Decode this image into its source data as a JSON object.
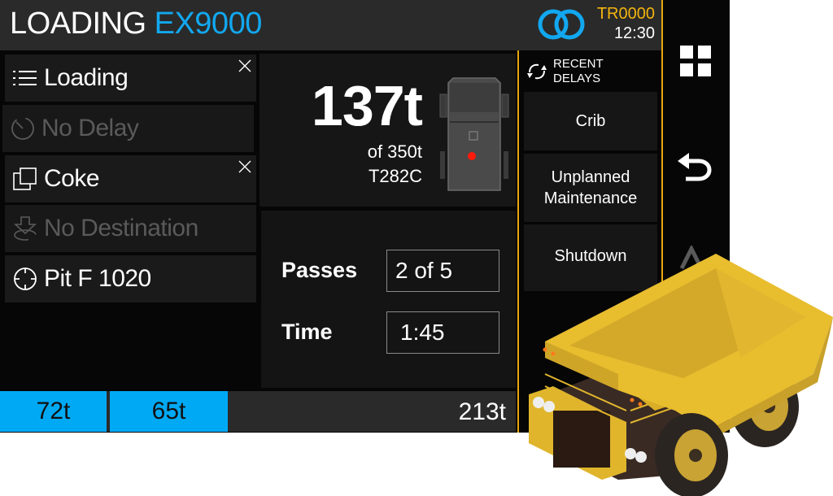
{
  "header": {
    "title_prefix": "LOADING",
    "title_machine": "EX9000",
    "truck_id": "TR0000",
    "clock": "12:30",
    "brand_icon": "linked-rings-icon"
  },
  "colors": {
    "accent_blue": "#12a8f0",
    "accent_yellow": "#f2b40f",
    "divider_orange": "#e8a70e",
    "load_red": "#ff1a0a"
  },
  "left_panel": {
    "items": [
      {
        "label": "Loading",
        "icon": "list-icon",
        "active": true,
        "closable": true
      },
      {
        "label": "No Delay",
        "icon": "timer-icon",
        "active": false,
        "closable": false
      },
      {
        "label": "Coke",
        "icon": "material-layers-icon",
        "active": true,
        "closable": true
      },
      {
        "label": "No Destination",
        "icon": "destination-download-icon",
        "active": false,
        "closable": false
      },
      {
        "label": "Pit F 1020",
        "icon": "crosshair-location-icon",
        "active": true,
        "closable": false
      }
    ]
  },
  "load_card": {
    "current_load": "137t",
    "capacity": "of 350t",
    "truck_model": "T282C"
  },
  "passes_card": {
    "passes_label": "Passes",
    "passes_value": "2 of 5",
    "time_label": "Time",
    "time_value": "1:45"
  },
  "recent_delays": {
    "title_line1": "RECENT",
    "title_line2": "DELAYS",
    "items": [
      {
        "label": "Crib"
      },
      {
        "label": "Unplanned Maintenance"
      },
      {
        "label": "Shutdown"
      }
    ]
  },
  "side_nav": {
    "items": [
      "grid-menu-icon",
      "undo-back-icon",
      "up-arrow-icon"
    ]
  },
  "bottom_bar": {
    "passes": [
      "72t",
      "65t"
    ],
    "remaining": "213t"
  }
}
